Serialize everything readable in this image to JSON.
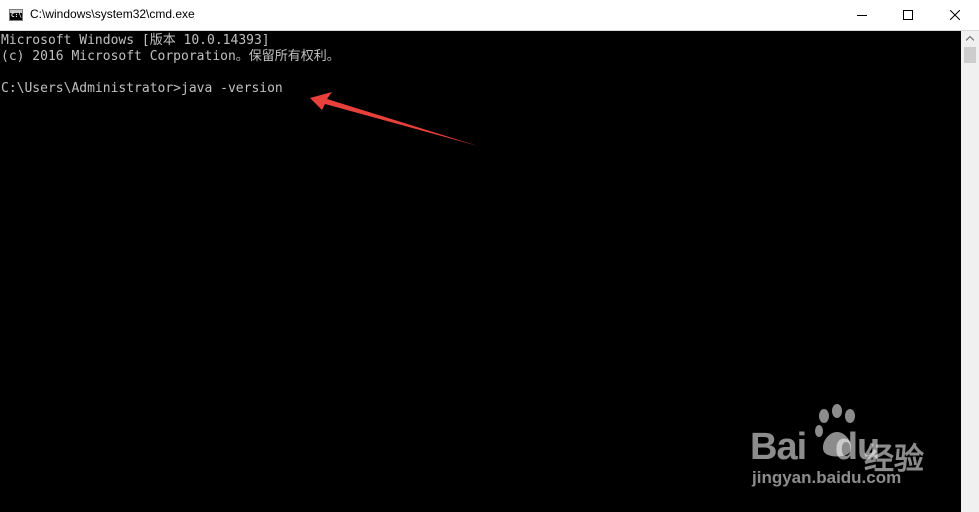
{
  "window": {
    "title": "C:\\windows\\system32\\cmd.exe",
    "icon": "cmd-icon",
    "icon_glyph": "C:\\"
  },
  "console": {
    "line1": "Microsoft Windows [版本 10.0.14393]",
    "line2": "(c) 2016 Microsoft Corporation。保留所有权利。",
    "prompt": "C:\\Users\\Administrator>",
    "command": "java -version"
  },
  "annotation": {
    "arrow_color": "#e8403a"
  },
  "watermark": {
    "brand": "Bai",
    "brand_suffix": "du",
    "chinese": "经验",
    "url": "jingyan.baidu.com"
  },
  "colors": {
    "console_bg": "#000000",
    "console_text": "#c0c0c0",
    "titlebar_bg": "#ffffff"
  }
}
